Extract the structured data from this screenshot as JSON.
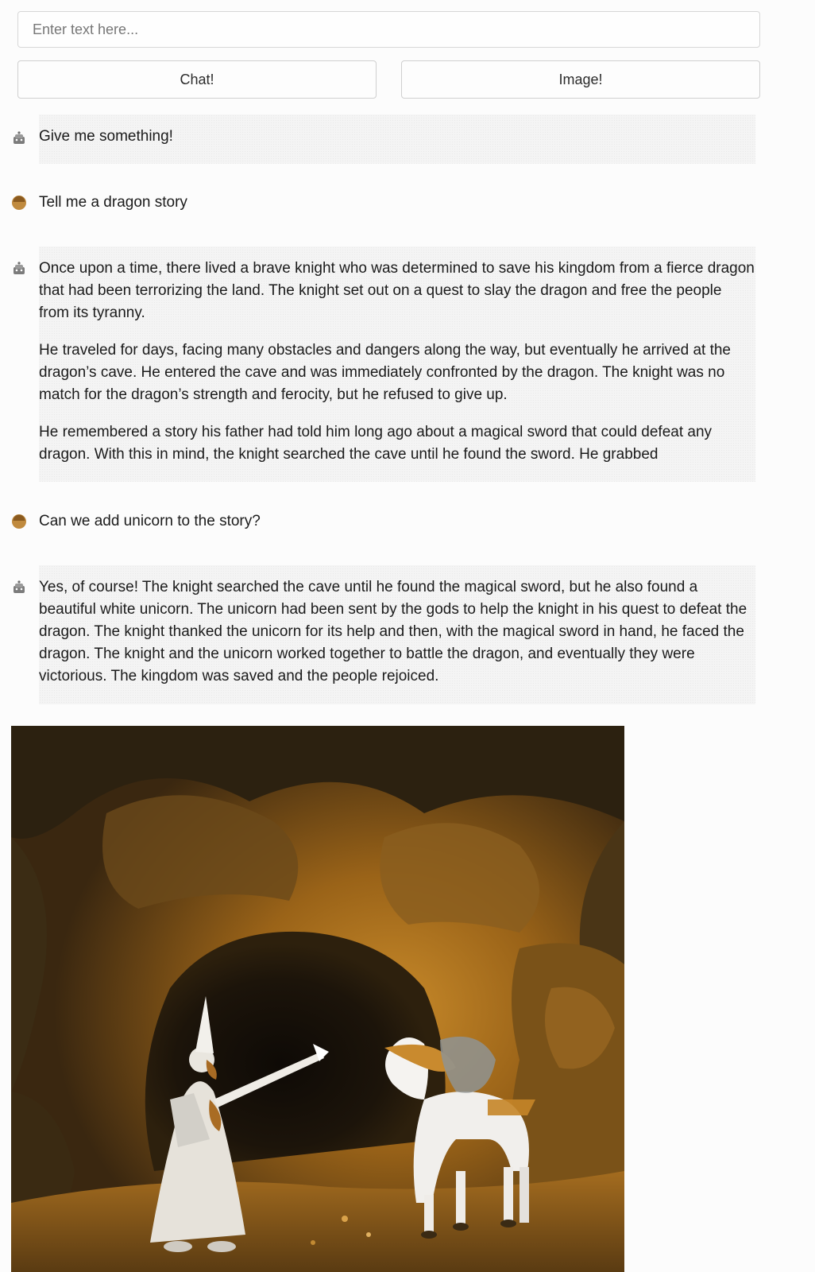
{
  "input": {
    "placeholder": "Enter text here...",
    "value": ""
  },
  "buttons": {
    "chat_label": "Chat!",
    "image_label": "Image!"
  },
  "messages": [
    {
      "role": "bot",
      "avatar": "robot-icon",
      "paragraphs": [
        "Give me something!"
      ]
    },
    {
      "role": "user",
      "avatar": "user-icon",
      "paragraphs": [
        "Tell me a dragon story"
      ]
    },
    {
      "role": "bot",
      "avatar": "robot-icon",
      "paragraphs": [
        "Once upon a time, there lived a brave knight who was determined to save his kingdom from a fierce dragon that had been terrorizing the land. The knight set out on a quest to slay the dragon and free the people from its tyranny.",
        "He traveled for days, facing many obstacles and dangers along the way, but eventually he arrived at the dragon’s cave. He entered the cave and was immediately confronted by the dragon. The knight was no match for the dragon’s strength and ferocity, but he refused to give up.",
        "He remembered a story his father had told him long ago about a magical sword that could defeat any dragon. With this in mind, the knight searched the cave until he found the sword. He grabbed"
      ]
    },
    {
      "role": "user",
      "avatar": "user-icon",
      "paragraphs": [
        "Can we add unicorn to the story?"
      ]
    },
    {
      "role": "bot",
      "avatar": "robot-icon",
      "paragraphs": [
        "Yes, of course! The knight searched the cave until he found the magical sword, but he also found a beautiful white unicorn. The unicorn had been sent by the gods to help the knight in his quest to defeat the dragon. The knight thanked the unicorn for its help and then, with the magical sword in hand, he faced the dragon. The knight and the unicorn worked together to battle the dragon, and eventually they were victorious. The kingdom was saved and the people rejoiced."
      ]
    }
  ],
  "generated_image": {
    "subject": "knight-and-unicorn-in-cave"
  }
}
